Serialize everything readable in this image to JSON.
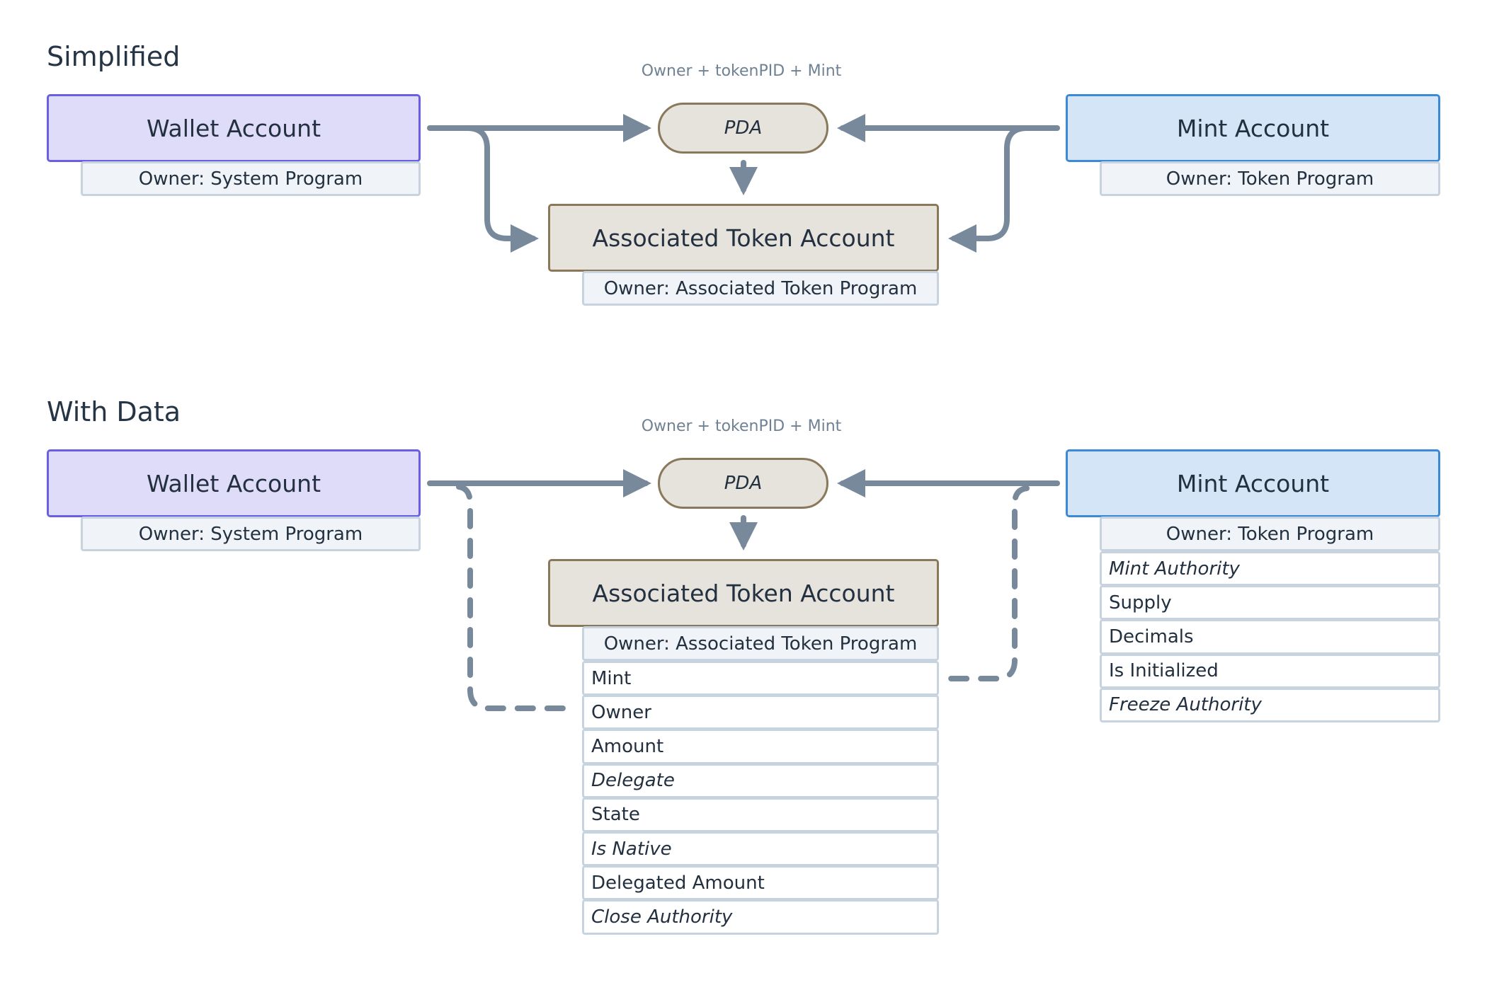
{
  "simplified": {
    "title": "Simplified",
    "pda_seed_label": "Owner + tokenPID + Mint",
    "pda": "PDA",
    "wallet": {
      "title": "Wallet Account",
      "owner": "Owner: System Program"
    },
    "mint": {
      "title": "Mint Account",
      "owner": "Owner: Token Program"
    },
    "ata": {
      "title": "Associated Token Account",
      "owner": "Owner: Associated Token Program"
    }
  },
  "with_data": {
    "title": "With Data",
    "pda_seed_label": "Owner + tokenPID + Mint",
    "pda": "PDA",
    "wallet": {
      "title": "Wallet Account",
      "owner": "Owner: System Program"
    },
    "mint": {
      "title": "Mint Account",
      "owner": "Owner: Token Program",
      "fields": [
        {
          "label": "Mint Authority",
          "optional": true
        },
        {
          "label": "Supply",
          "optional": false
        },
        {
          "label": "Decimals",
          "optional": false
        },
        {
          "label": "Is Initialized",
          "optional": false
        },
        {
          "label": "Freeze Authority",
          "optional": true
        }
      ]
    },
    "ata": {
      "title": "Associated Token Account",
      "owner": "Owner: Associated Token Program",
      "fields": [
        {
          "label": "Mint",
          "optional": false
        },
        {
          "label": "Owner",
          "optional": false
        },
        {
          "label": "Amount",
          "optional": false
        },
        {
          "label": "Delegate",
          "optional": true
        },
        {
          "label": "State",
          "optional": false
        },
        {
          "label": "Is Native",
          "optional": true
        },
        {
          "label": "Delegated Amount",
          "optional": false
        },
        {
          "label": "Close Authority",
          "optional": true
        }
      ]
    }
  },
  "colors": {
    "wallet_fill": "#dfdcfa",
    "wallet_border": "#6a5fe4",
    "mint_fill": "#d3e5f6",
    "mint_border": "#3a8ad8",
    "ata_fill": "#e6e2dc",
    "ata_border": "#8a785a",
    "connector": "#77899a"
  }
}
